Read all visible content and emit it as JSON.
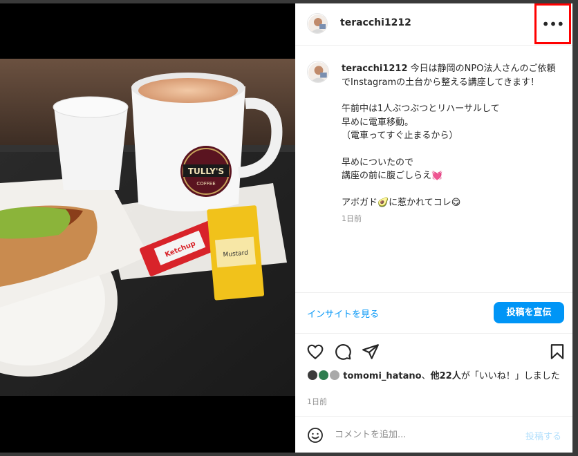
{
  "post": {
    "username": "teracchi1212",
    "more_icon": "more-horizontal-icon",
    "caption": {
      "line1": "今日は静岡のNPO法人さんのご依頼でInstagramの土台から整える講座してきます！",
      "para2": [
        "午前中は1人ぶつぶつとリハーサルして",
        "早めに電車移動。",
        "（電車ってすぐ止まるから）"
      ],
      "para3": [
        "早めについたので",
        "講座の前に腹ごしらえ💓"
      ],
      "para4": "アボガド🥑に惹かれてコレ😋",
      "time": "1日前"
    },
    "insights_link": "インサイトを見る",
    "promote_button": "投稿を宣伝",
    "action_icons": [
      "heart-icon",
      "comment-icon",
      "share-icon",
      "bookmark-icon"
    ],
    "likes": {
      "user": "tomomi_hatano",
      "sep": "、",
      "others": "他22人",
      "suffix": "が「いいね！」しました"
    },
    "date": "1日前",
    "comment_placeholder": "コメントを追加...",
    "post_button": "投稿する",
    "emoji_icon": "emoji-smile-icon"
  },
  "photo": {
    "cup_logo": "TULLY'S",
    "cup_logo_sub": "COFFEE",
    "packet1": "Ketchup",
    "packet2": "Mustard"
  },
  "colors": {
    "accent": "#0095f6",
    "highlight_border": "#ff0000",
    "text": "#262626",
    "muted": "#8e8e8e"
  }
}
